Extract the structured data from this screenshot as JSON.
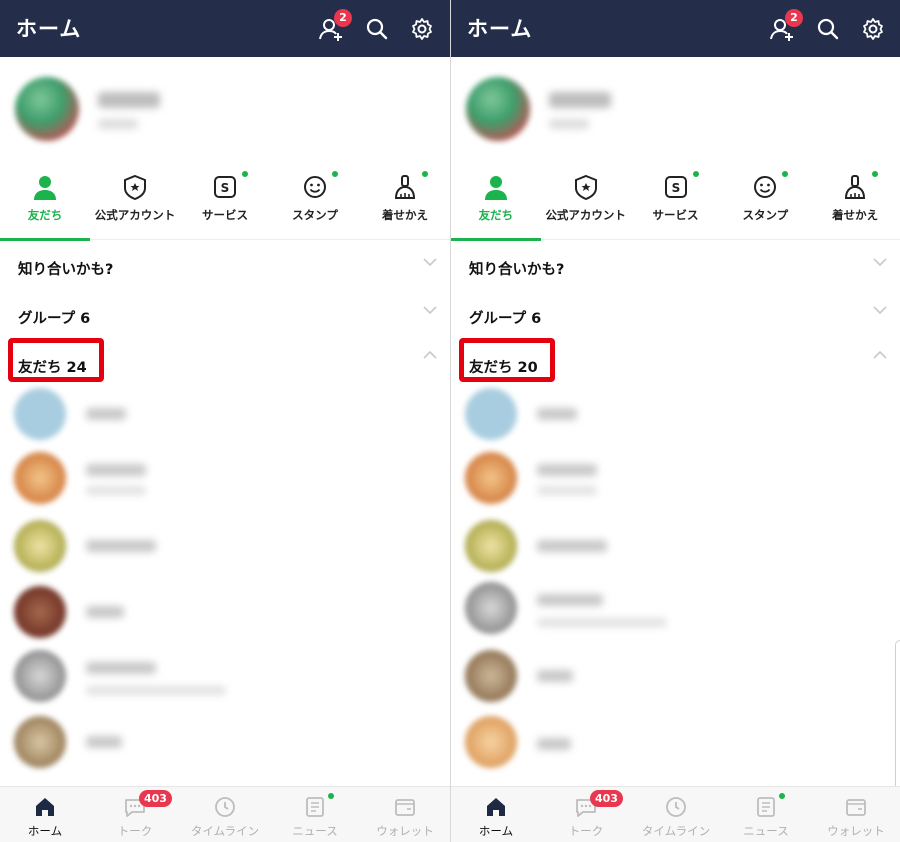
{
  "panels": [
    {
      "header": {
        "title": "ホーム",
        "add_friend_badge": "2"
      },
      "tabs": [
        {
          "label": "友だち",
          "icon": "person-icon"
        },
        {
          "label": "公式アカウント",
          "icon": "official-account-icon"
        },
        {
          "label": "サービス",
          "icon": "service-icon"
        },
        {
          "label": "スタンプ",
          "icon": "sticker-icon"
        },
        {
          "label": "着せかえ",
          "icon": "theme-brush-icon"
        }
      ],
      "sections": {
        "suggested": "知り合いかも?",
        "groups": "グループ 6",
        "friends": "友だち 24"
      },
      "bottom_nav": [
        {
          "label": "ホーム",
          "icon": "home-icon"
        },
        {
          "label": "トーク",
          "icon": "chat-icon",
          "badge": "403"
        },
        {
          "label": "タイムライン",
          "icon": "clock-icon"
        },
        {
          "label": "ニュース",
          "icon": "news-icon"
        },
        {
          "label": "ウォレット",
          "icon": "wallet-icon"
        }
      ]
    },
    {
      "header": {
        "title": "ホーム",
        "add_friend_badge": "2"
      },
      "tabs": [
        {
          "label": "友だち",
          "icon": "person-icon"
        },
        {
          "label": "公式アカウント",
          "icon": "official-account-icon"
        },
        {
          "label": "サービス",
          "icon": "service-icon"
        },
        {
          "label": "スタンプ",
          "icon": "sticker-icon"
        },
        {
          "label": "着せかえ",
          "icon": "theme-brush-icon"
        }
      ],
      "sections": {
        "suggested": "知り合いかも?",
        "groups": "グループ 6",
        "friends": "友だち 20"
      },
      "bottom_nav": [
        {
          "label": "ホーム",
          "icon": "home-icon"
        },
        {
          "label": "トーク",
          "icon": "chat-icon",
          "badge": "403"
        },
        {
          "label": "タイムライン",
          "icon": "clock-icon"
        },
        {
          "label": "ニュース",
          "icon": "news-icon"
        },
        {
          "label": "ウォレット",
          "icon": "wallet-icon"
        }
      ]
    }
  ],
  "colors": {
    "header_bg": "#242e4a",
    "accent_green": "#1bb34c",
    "badge_red": "#e8374e",
    "highlight_red": "#e4000f"
  }
}
